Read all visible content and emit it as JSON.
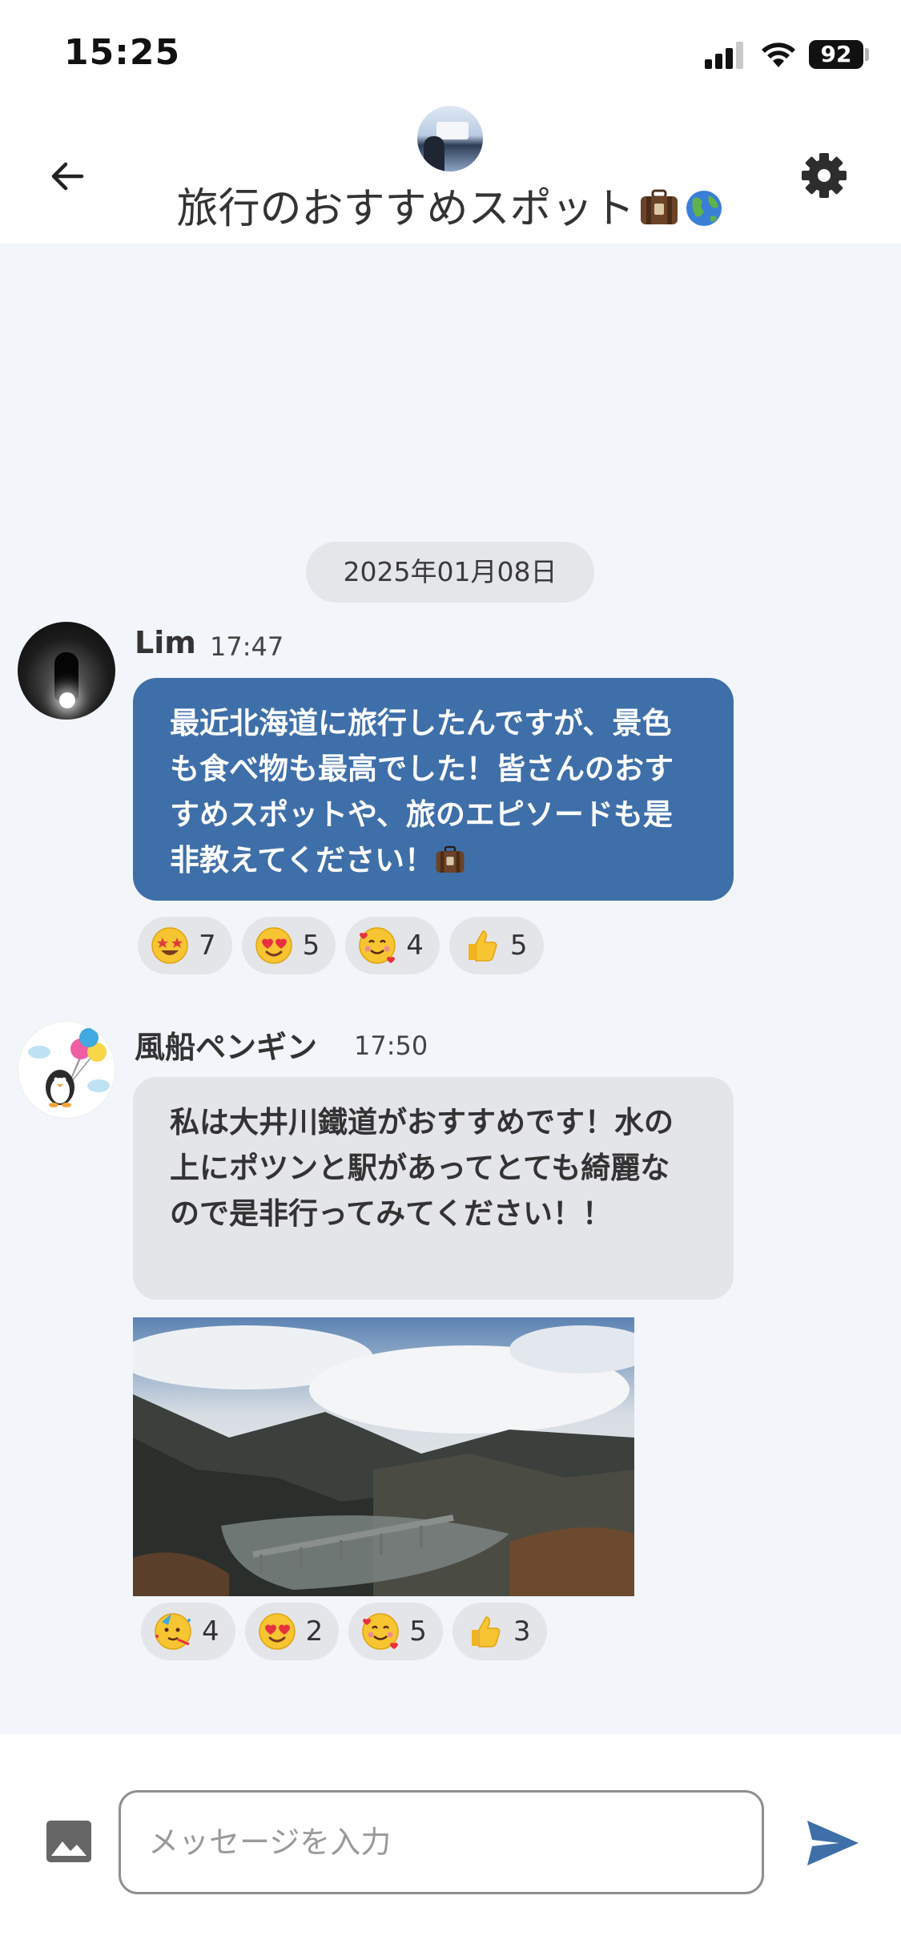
{
  "status_bar": {
    "time": "15:25",
    "battery": "92"
  },
  "header": {
    "title": "旅行のおすすめスポット",
    "title_emojis": [
      "luggage-emoji",
      "globe-emoji"
    ]
  },
  "chat": {
    "date": "2025年01月08日",
    "messages": [
      {
        "sender": "Lim",
        "time": "17:47",
        "text": "最近北海道に旅行したんですが、景色も食べ物も最高でした！皆さんのおすすめスポットや、旅のエピソードも是非教えてください！",
        "trailing_emoji": "luggage-emoji",
        "reactions": [
          {
            "emoji": "star-struck",
            "count": "7"
          },
          {
            "emoji": "heart-eyes",
            "count": "5"
          },
          {
            "emoji": "smiling-face-with-hearts",
            "count": "4"
          },
          {
            "emoji": "thumbs-up",
            "count": "5"
          }
        ]
      },
      {
        "sender": "風船ペンギン",
        "time": "17:50",
        "text": "私は大井川鐵道がおすすめです！水の上にポツンと駅があってとても綺麗なので是非行ってみてください！！",
        "photo": "mountain-lake-bridge-photo",
        "reactions": [
          {
            "emoji": "partying-face",
            "count": "4"
          },
          {
            "emoji": "heart-eyes",
            "count": "2"
          },
          {
            "emoji": "smiling-face-with-hearts",
            "count": "5"
          },
          {
            "emoji": "thumbs-up",
            "count": "3"
          }
        ]
      }
    ]
  },
  "composer": {
    "placeholder": "メッセージを入力"
  },
  "colors": {
    "accent": "#3e6fa9",
    "background": "#f2f5fa",
    "bubble_gray": "#e4e5e9"
  }
}
